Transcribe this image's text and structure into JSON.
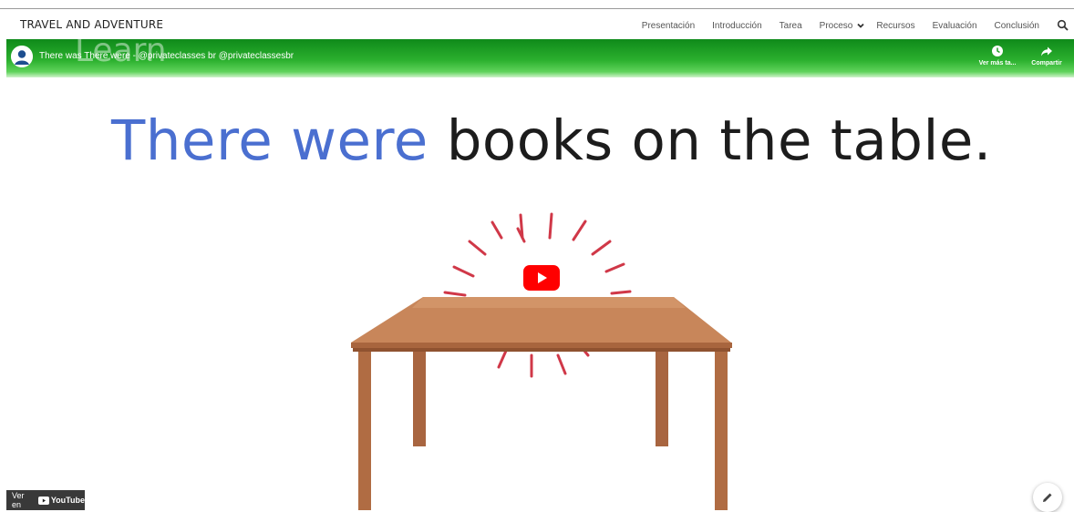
{
  "site": {
    "title": "TRAVEL AND ADVENTURE"
  },
  "nav": {
    "items": [
      "Presentación",
      "Introducción",
      "Tarea",
      "Proceso",
      "Recursos",
      "Evaluación",
      "Conclusión"
    ],
    "icons": {
      "dropdown": "chevron-down-icon",
      "search": "search-icon"
    }
  },
  "video": {
    "title": "There was There were - @privateclasses br @privateclassesbr",
    "ghost_text": "Learn",
    "channel_icon": "avatar-icon",
    "controls": {
      "watch_later": "Ver más ta...",
      "share": "Compartir"
    },
    "sentence": {
      "highlight": "There were",
      "rest": " books on the table."
    },
    "watch_on": {
      "prefix": "Ver en",
      "brand": "YouTube"
    }
  },
  "colors": {
    "titlebar": "#1fa024",
    "highlight": "#4a6fd0",
    "play": "#ff0000",
    "table": "#c07a4f"
  }
}
